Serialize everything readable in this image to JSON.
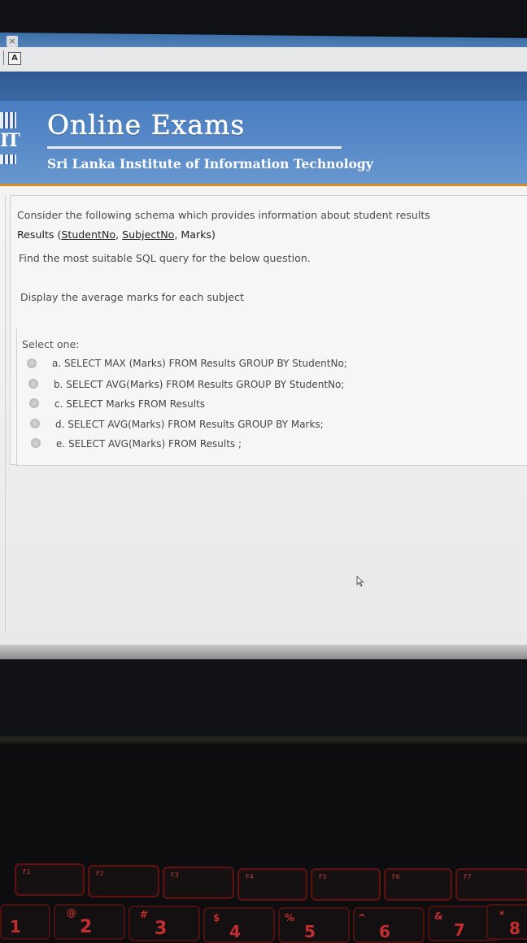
{
  "browser": {
    "tab_close_glyph": "×",
    "toolbar_icon": "A"
  },
  "banner": {
    "logo_letters": "IT",
    "title": "Online Exams",
    "subtitle": "Sri Lanka Institute of Information Technology"
  },
  "question": {
    "intro": "Consider the following schema which provides information about student results",
    "schema_prefix": "Results (",
    "schema_key1": "StudentNo",
    "schema_sep": ", ",
    "schema_key2": "SubjectNo",
    "schema_suffix": ", Marks)",
    "instruction": "Find the most suitable SQL query for the below question.",
    "task": "Display the average marks for each subject"
  },
  "answer": {
    "prompt": "Select one:",
    "options": [
      {
        "label": "a. SELECT MAX (Marks) FROM Results GROUP BY StudentNo;"
      },
      {
        "label": "b. SELECT AVG(Marks) FROM Results GROUP BY StudentNo;"
      },
      {
        "label": "c. SELECT Marks FROM Results"
      },
      {
        "label": "d. SELECT AVG(Marks) FROM Results GROUP BY Marks;"
      },
      {
        "label": "e. SELECT AVG(Marks) FROM Results ;"
      }
    ]
  },
  "keyboard": {
    "fkeys": [
      "F1",
      "F2",
      "F3",
      "F4",
      "F5",
      "F6",
      "F7"
    ],
    "num_glyphs": [
      "1",
      "@",
      "2",
      "#",
      "3",
      "$",
      "4",
      "%",
      "5",
      "^",
      "6",
      "&",
      "7",
      "*",
      "8"
    ]
  },
  "colors": {
    "banner_blue": "#4a7dc0",
    "accent_orange": "#d98b2a",
    "keyboard_red": "#c22e2e"
  }
}
